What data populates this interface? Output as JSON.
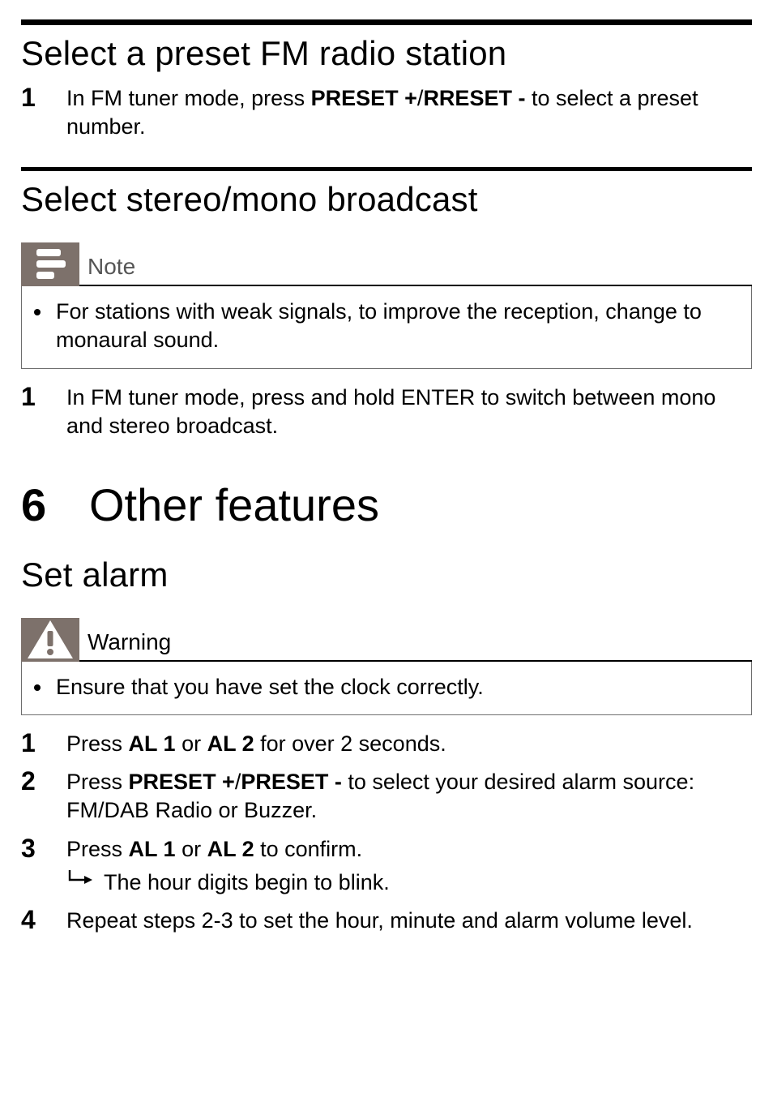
{
  "sections": {
    "selectPreset": {
      "title": "Select a preset FM radio station",
      "step1_a": "In FM tuner mode, press ",
      "step1_b1": "PRESET +",
      "step1_slash": "/",
      "step1_b2": "RRESET -",
      "step1_c": " to select a preset number."
    },
    "stereoMono": {
      "title": "Select stereo/mono broadcast",
      "noteLabel": "Note",
      "noteItem": "For stations with weak signals, to improve the reception, change to monaural sound.",
      "step1": "In FM tuner mode, press and hold ENTER to switch between mono and stereo broadcast."
    },
    "chapter": {
      "num": "6",
      "title": "Other features"
    },
    "setAlarm": {
      "title": "Set alarm",
      "warnLabel": "Warning",
      "warnItem": "Ensure that you have set the clock correctly.",
      "s1_a": "Press ",
      "s1_b1": "AL 1",
      "s1_or": " or ",
      "s1_b2": "AL 2",
      "s1_c": " for over 2 seconds.",
      "s2_a": "Press ",
      "s2_b1": "PRESET +",
      "s2_slash": "/",
      "s2_b2": "PRESET -",
      "s2_c": " to select your desired alarm source: FM/DAB Radio or Buzzer.",
      "s3_a": "Press ",
      "s3_b1": "AL 1",
      "s3_or": " or ",
      "s3_b2": "AL 2",
      "s3_c": " to confirm.",
      "s3_sub": "The hour digits begin to blink.",
      "s4": "Repeat steps 2-3 to set the hour, minute and alarm volume level."
    }
  },
  "nums": {
    "n1": "1",
    "n2": "2",
    "n3": "3",
    "n4": "4"
  }
}
